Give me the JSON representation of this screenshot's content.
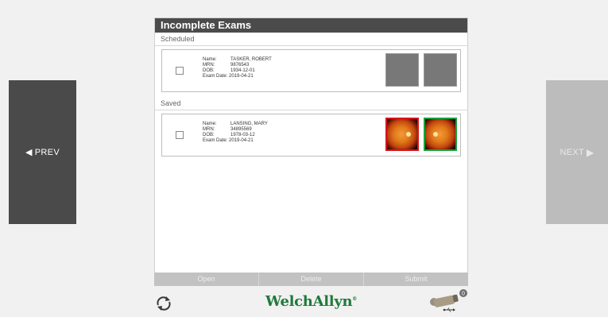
{
  "nav": {
    "prev_label": "PREV",
    "next_label": "NEXT"
  },
  "panel": {
    "title": "Incomplete Exams",
    "sections": [
      {
        "label": "Scheduled",
        "exam": {
          "name_key": "Name:",
          "name": "TASKER, ROBERT",
          "mrn_key": "MRN:",
          "mrn": "9876543",
          "dob_key": "DOB:",
          "dob": "1934-12-01",
          "exam_date_key": "Exam Date:",
          "exam_date": "2019-04-21",
          "images": [
            "empty",
            "empty"
          ]
        }
      },
      {
        "label": "Saved",
        "exam": {
          "name_key": "Name:",
          "name": "LANSING, MARY",
          "mrn_key": "MRN:",
          "mrn": "34895569",
          "dob_key": "DOB:",
          "dob": "1978-03-12",
          "exam_date_key": "Exam Date:",
          "exam_date": "2019-04-21",
          "images": [
            "fundus-red-border",
            "fundus-green-border"
          ]
        }
      }
    ]
  },
  "actions": {
    "open": "Open",
    "delete": "Delete",
    "submit": "Submit"
  },
  "footer": {
    "brand": "WelchAllyn",
    "trademark": "®",
    "device_badge": "0",
    "icons": [
      "refresh-icon",
      "camera-usb-device-icon"
    ]
  },
  "colors": {
    "header_bg": "#4b4b4b",
    "prev_bg": "#4a4a4a",
    "next_bg": "#bcbcbc",
    "brand_green": "#1f7a3a",
    "selected_red": "#d8141a",
    "selected_green": "#1aa13a"
  }
}
